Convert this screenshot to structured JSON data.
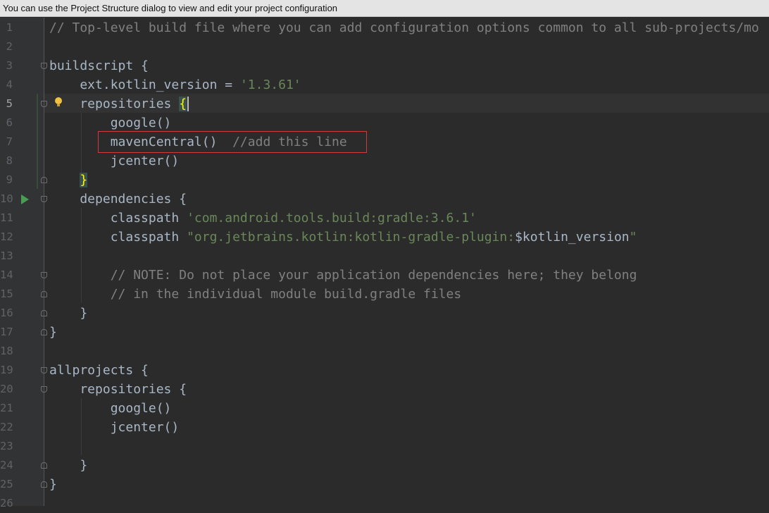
{
  "banner": {
    "text": "You can use the Project Structure dialog to view and edit your project configuration"
  },
  "gutter": {
    "line_numbers": [
      "1",
      "2",
      "3",
      "4",
      "5",
      "6",
      "7",
      "8",
      "9",
      "10",
      "11",
      "12",
      "13",
      "14",
      "15",
      "16",
      "17",
      "18",
      "19",
      "20",
      "21",
      "22",
      "23",
      "24",
      "25",
      "26"
    ]
  },
  "editor": {
    "lines": [
      [
        "// Top-level build file where you can add configuration options common to all sub-projects/mo"
      ],
      [
        ""
      ],
      [
        "buildscript {"
      ],
      [
        "    ext.kotlin_version = ",
        "'1.3.61'"
      ],
      [
        "    repositories ",
        "{"
      ],
      [
        "        google()"
      ],
      [
        "        mavenCentral()",
        "  //add this line"
      ],
      [
        "        jcenter()"
      ],
      [
        "    ",
        "}"
      ],
      [
        "    dependencies {"
      ],
      [
        "        classpath ",
        "'com.android.tools.build:gradle:3.6.1'"
      ],
      [
        "        classpath ",
        "\"org.jetbrains.kotlin:kotlin-gradle-plugin:",
        "$kotlin_version",
        "\""
      ],
      [
        ""
      ],
      [
        "        // NOTE: Do not place your application dependencies here; they belong"
      ],
      [
        "        // in the individual module build.gradle files"
      ],
      [
        "    }"
      ],
      [
        "}"
      ],
      [
        ""
      ],
      [
        "allprojects {"
      ],
      [
        "    repositories {"
      ],
      [
        "        google()"
      ],
      [
        "        jcenter()"
      ],
      [
        ""
      ],
      [
        "    }"
      ],
      [
        "}"
      ],
      [
        ""
      ]
    ]
  },
  "icons": {
    "intention": "lightbulb-icon",
    "run": "run-gutter-icon",
    "fold": "fold-icon"
  },
  "colors": {
    "background": "#2b2b2b",
    "comment": "#808080",
    "string": "#6a8759",
    "text": "#a9b7c6",
    "highlight_box": "#d03a3a"
  }
}
